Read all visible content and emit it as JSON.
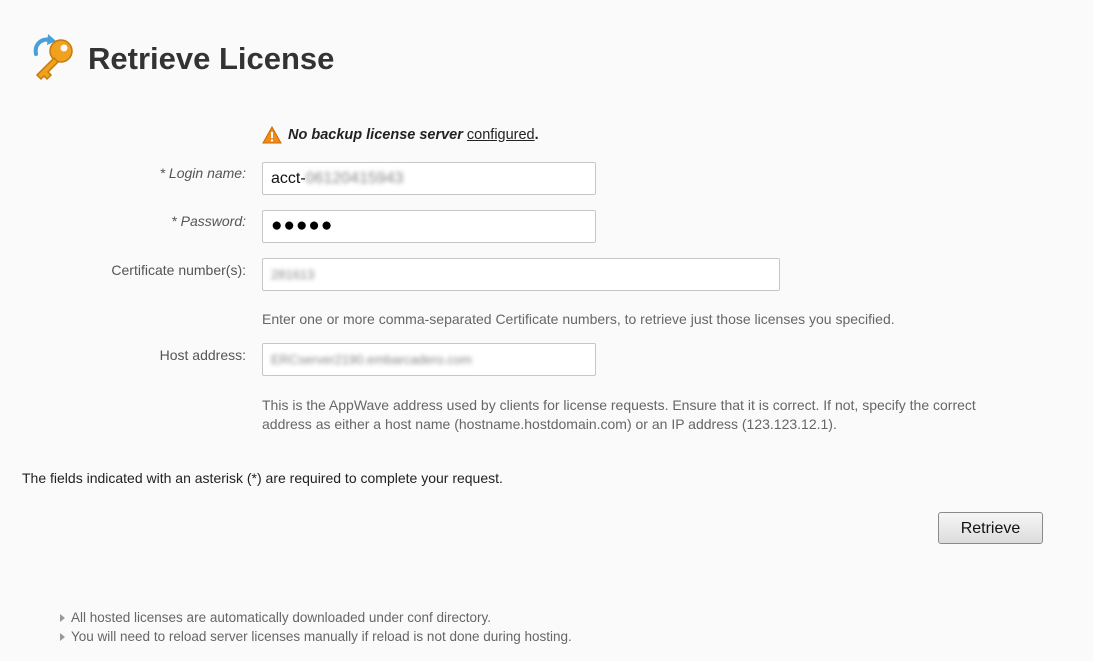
{
  "header": {
    "title": "Retrieve License",
    "icon": "key-icon"
  },
  "warning": {
    "text": "No backup license server",
    "link": "configured",
    "end": "."
  },
  "form": {
    "login": {
      "label": "* Login name:",
      "value_prefix": "acct-",
      "value_blurred": "06120415943"
    },
    "password": {
      "label": "* Password:",
      "value": "●●●●●"
    },
    "certificate": {
      "label": "Certificate number(s):",
      "value_blurred": "281613",
      "hint": "Enter one or more comma-separated Certificate numbers, to retrieve just those licenses you specified."
    },
    "host": {
      "label": "Host address:",
      "value_blurred": "ERCserver2190.embarcadero.com",
      "hint": "This is the AppWave address used by clients for license requests. Ensure that it is correct. If not, specify the correct address as either a host name (hostname.hostdomain.com) or an IP address (123.123.12.1)."
    }
  },
  "required_note": "The fields indicated with an asterisk (*) are required to complete your request.",
  "retrieve_button": "Retrieve",
  "notes": [
    "All hosted licenses are automatically downloaded under conf directory.",
    "You will need to reload server licenses manually if reload is not done during hosting."
  ],
  "colors": {
    "warning_orange": "#f08a1c",
    "key_gold": "#f0a21e",
    "arrow_blue": "#4a9fd8"
  }
}
